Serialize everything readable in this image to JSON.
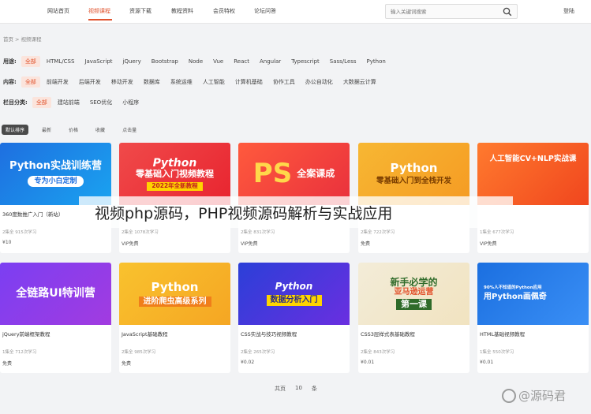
{
  "nav": {
    "items": [
      "网站首页",
      "视频课程",
      "资源下载",
      "教程资料",
      "会员特权",
      "论坛问答"
    ],
    "active_index": 1,
    "search_placeholder": "输入关键词搜索",
    "login": "登陆"
  },
  "breadcrumb": {
    "home": "首页",
    "sep": ">",
    "current": "视频课程"
  },
  "filters": {
    "usage": {
      "label": "用途:",
      "options": [
        "全部",
        "HTML/CSS",
        "JavaScript",
        "jQuery",
        "Bootstrap",
        "Node",
        "Vue",
        "React",
        "Angular",
        "Typescript",
        "Sass/Less",
        "Python"
      ]
    },
    "content": {
      "label": "内容:",
      "options": [
        "全部",
        "前端开发",
        "后端开发",
        "移动开发",
        "数据库",
        "系统运维",
        "人工智能",
        "计算机基础",
        "协作工具",
        "办公自动化",
        "大数据云计算"
      ]
    },
    "column": {
      "label": "栏目分类:",
      "options": [
        "全部",
        "建站前端",
        "SEO优化",
        "小程序"
      ]
    }
  },
  "sort": [
    "默认排序",
    "最新",
    "价格",
    "收藏",
    "点击量"
  ],
  "courses": [
    {
      "thumb_lines": [
        "Python实战训练营",
        "专为小白定制"
      ],
      "name": "360度数推广入门（新站）",
      "learners": "2集全 915次学习",
      "price": "¥10"
    },
    {
      "thumb_lines": [
        "Python",
        "零基础入门视频教程",
        "2022年全新教程"
      ],
      "name": "",
      "learners": "2集全 1078次学习",
      "price": "VIP免费"
    },
    {
      "thumb_lines": [
        "PS",
        "全案课成"
      ],
      "name": "",
      "learners": "2集全 831次学习",
      "price": "VIP免费"
    },
    {
      "thumb_lines": [
        "Python",
        "零基础入门到全栈开发"
      ],
      "name": "",
      "learners": "2集全 722次学习",
      "price": "免费"
    },
    {
      "thumb_lines": [
        "人工智能CV+NLP实战课"
      ],
      "name": "",
      "learners": "1集全 677次学习",
      "price": "VIP免费"
    },
    {
      "thumb_lines": [
        "全链路UI特训营"
      ],
      "name": "jQuery前端框架教程",
      "learners": "1集全 712次学习",
      "price": "免费"
    },
    {
      "thumb_lines": [
        "Python",
        "进阶爬虫高级系列"
      ],
      "name": "JavaScript基础教程",
      "learners": "2集全 985次学习",
      "price": "免费"
    },
    {
      "thumb_lines": [
        "Python",
        "数据分析入门"
      ],
      "name": "CSS实战与技巧视频教程",
      "learners": "2集全 265次学习",
      "price": "¥0.02"
    },
    {
      "thumb_lines": [
        "新手必学的",
        "亚马逊运营",
        "第一课"
      ],
      "name": "CSS3层样式表基础教程",
      "learners": "2集全 843次学习",
      "price": "¥0.01"
    },
    {
      "thumb_lines": [
        "90%人不知道的Python应用",
        "用Python画佩奇"
      ],
      "name": "HTML基础视频教程",
      "learners": "1集全 550次学习",
      "price": "¥0.01"
    }
  ],
  "pager": {
    "total_label": "共页",
    "count": "10",
    "unit": "条"
  },
  "overlay_title": "视频php源码，PHP视频源码解析与实战应用",
  "watermark": "@源码君",
  "colors": {
    "accent": "#e0532e"
  }
}
